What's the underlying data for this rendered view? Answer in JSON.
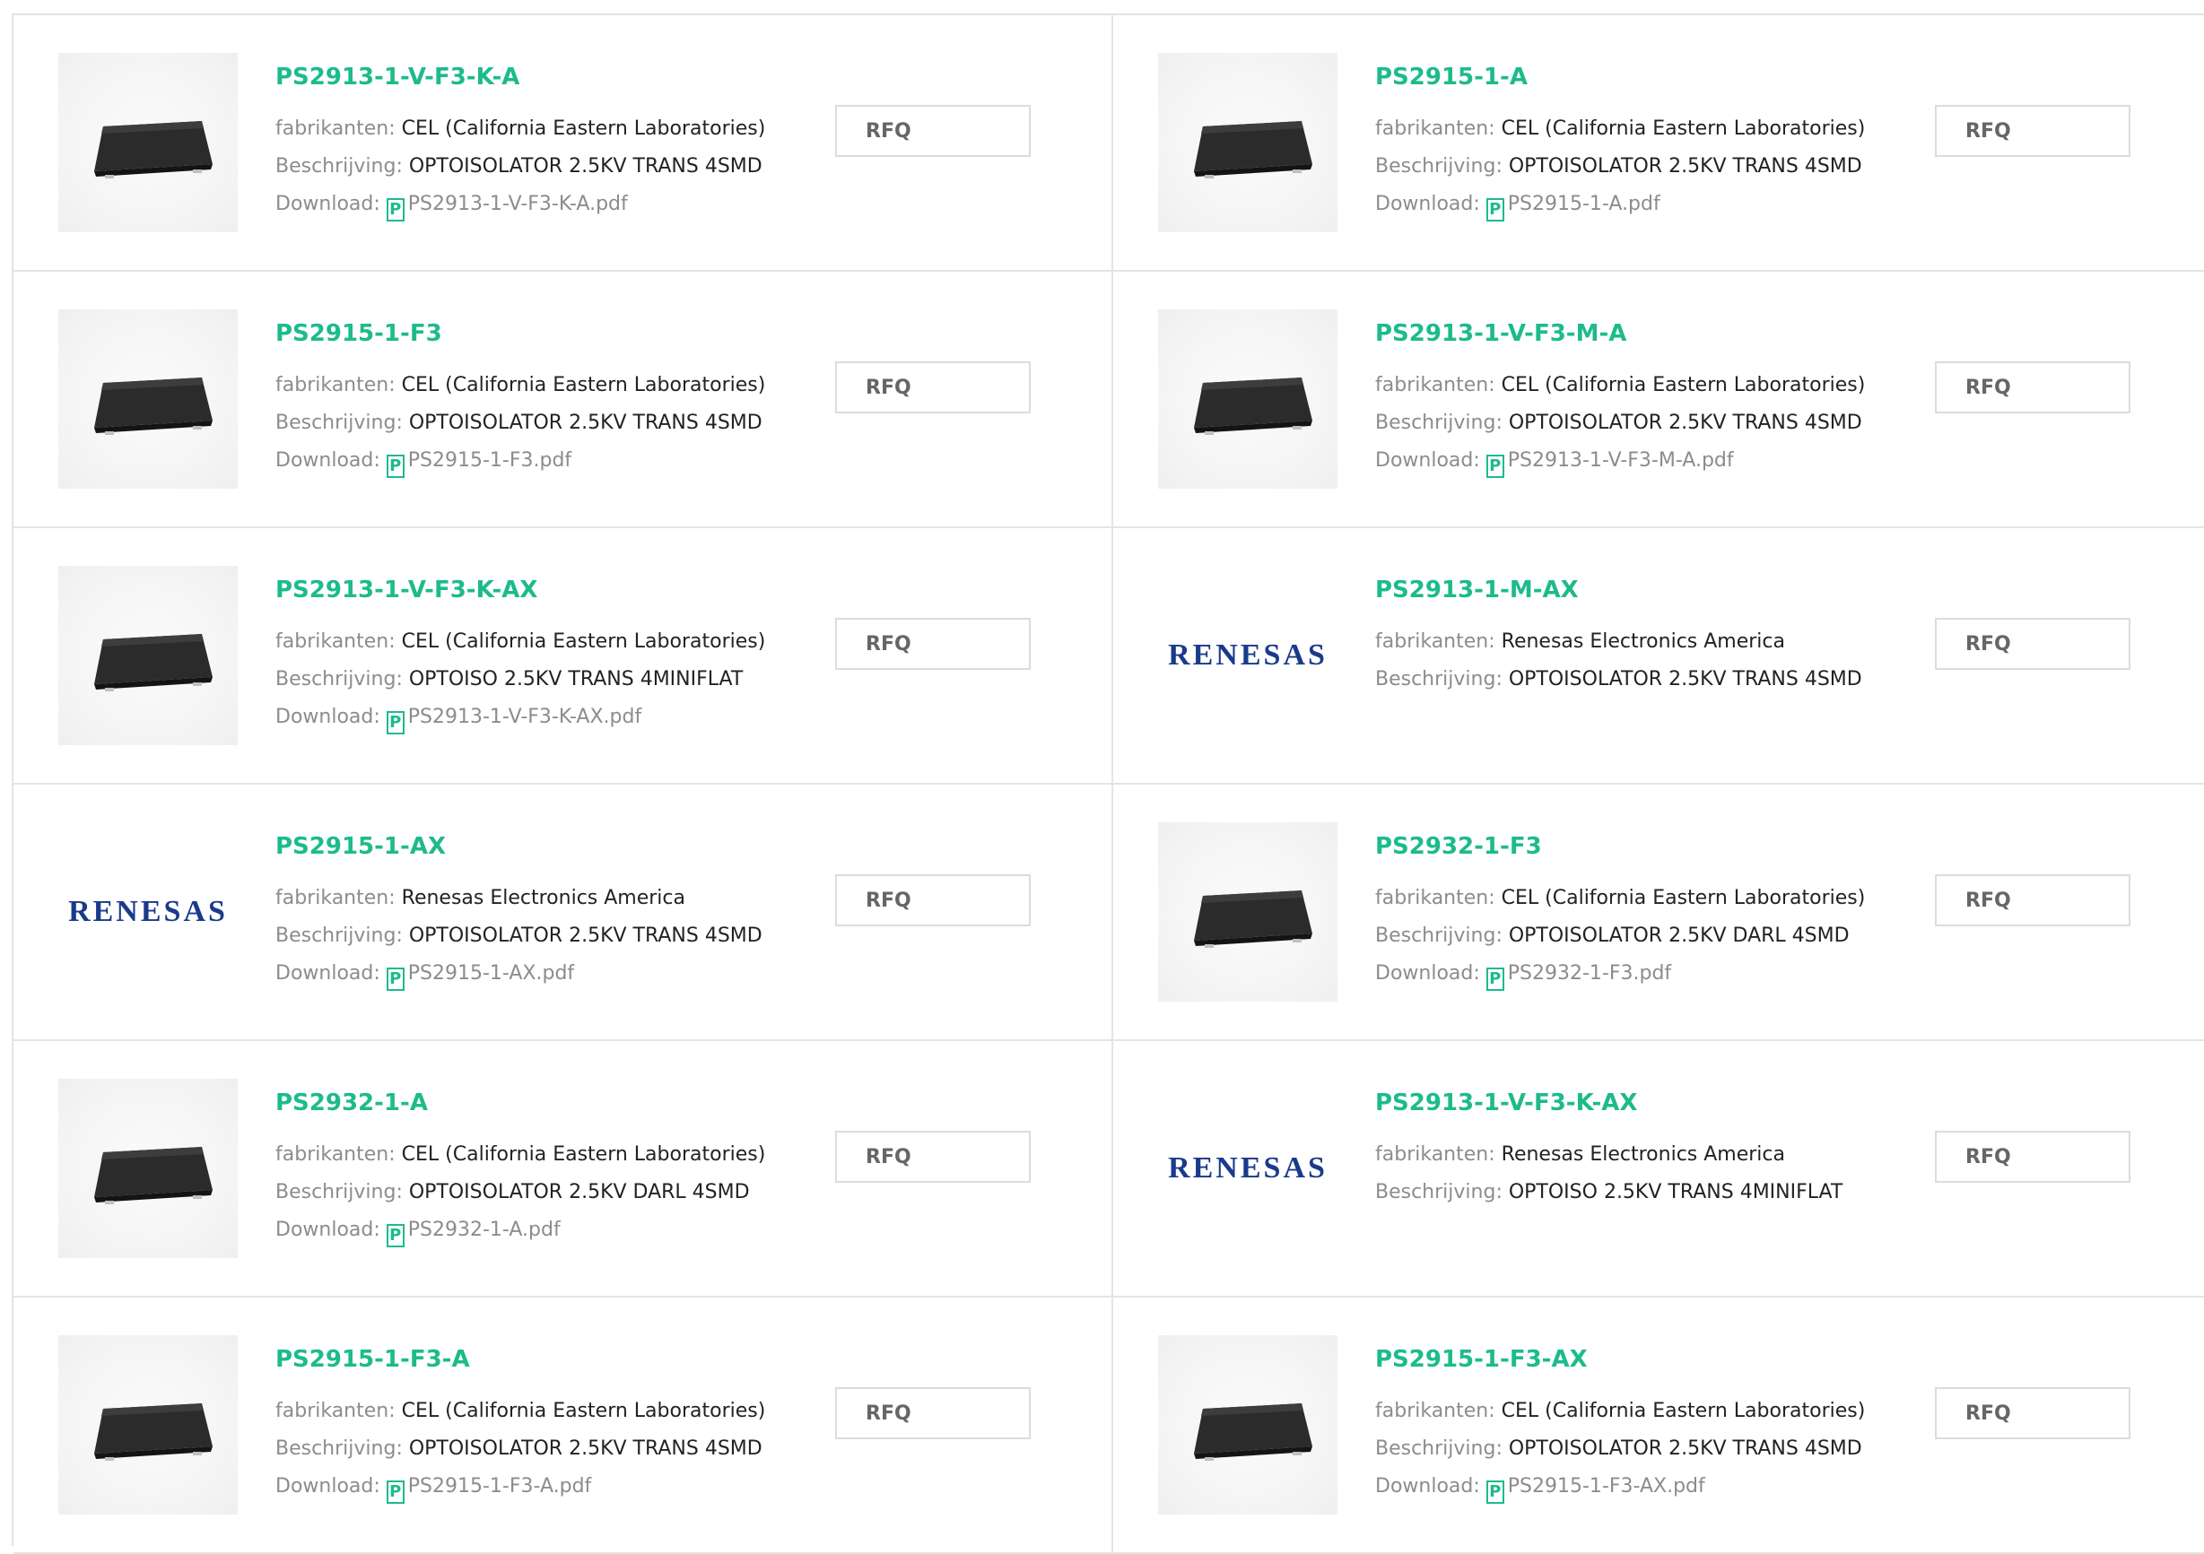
{
  "labels": {
    "manufacturer": "fabrikanten: ",
    "description": "Beschrijving: ",
    "download": "Download: ",
    "rfq": "RFQ"
  },
  "colors": {
    "accent": "#1dbb8c",
    "label_gray": "#8c8c8c",
    "border": "#e4e4e4",
    "renesas_blue": "#1a3a8c"
  },
  "products": [
    {
      "pn": "PS2913-1-V-F3-K-A",
      "manufacturer": "CEL (California Eastern Laboratories)",
      "description": "OPTOISOLATOR 2.5KV TRANS 4SMD",
      "pdf": "PS2913-1-V-F3-K-A.pdf",
      "image": "chip",
      "image_text": ""
    },
    {
      "pn": "PS2915-1-A",
      "manufacturer": "CEL (California Eastern Laboratories)",
      "description": "OPTOISOLATOR 2.5KV TRANS 4SMD",
      "pdf": "PS2915-1-A.pdf",
      "image": "chip",
      "image_text": ""
    },
    {
      "pn": "PS2915-1-F3",
      "manufacturer": "CEL (California Eastern Laboratories)",
      "description": "OPTOISOLATOR 2.5KV TRANS 4SMD",
      "pdf": "PS2915-1-F3.pdf",
      "image": "chip",
      "image_text": ""
    },
    {
      "pn": "PS2913-1-V-F3-M-A",
      "manufacturer": "CEL (California Eastern Laboratories)",
      "description": "OPTOISOLATOR 2.5KV TRANS 4SMD",
      "pdf": "PS2913-1-V-F3-M-A.pdf",
      "image": "chip",
      "image_text": ""
    },
    {
      "pn": "PS2913-1-V-F3-K-AX",
      "manufacturer": "CEL (California Eastern Laboratories)",
      "description": "OPTOISO 2.5KV TRANS 4MINIFLAT",
      "pdf": "PS2913-1-V-F3-K-AX.pdf",
      "image": "chip",
      "image_text": ""
    },
    {
      "pn": "PS2913-1-M-AX",
      "manufacturer": "Renesas Electronics America",
      "description": "OPTOISOLATOR 2.5KV TRANS 4SMD",
      "pdf": "",
      "image": "logo",
      "image_text": "RENESAS"
    },
    {
      "pn": "PS2915-1-AX",
      "manufacturer": "Renesas Electronics America",
      "description": "OPTOISOLATOR 2.5KV TRANS 4SMD",
      "pdf": "PS2915-1-AX.pdf",
      "image": "logo",
      "image_text": "RENESAS"
    },
    {
      "pn": "PS2932-1-F3",
      "manufacturer": "CEL (California Eastern Laboratories)",
      "description": "OPTOISOLATOR 2.5KV DARL 4SMD",
      "pdf": "PS2932-1-F3.pdf",
      "image": "chip",
      "image_text": ""
    },
    {
      "pn": "PS2932-1-A",
      "manufacturer": "CEL (California Eastern Laboratories)",
      "description": "OPTOISOLATOR 2.5KV DARL 4SMD",
      "pdf": "PS2932-1-A.pdf",
      "image": "chip",
      "image_text": ""
    },
    {
      "pn": "PS2913-1-V-F3-K-AX",
      "manufacturer": "Renesas Electronics America",
      "description": "OPTOISO 2.5KV TRANS 4MINIFLAT",
      "pdf": "",
      "image": "logo",
      "image_text": "RENESAS"
    },
    {
      "pn": "PS2915-1-F3-A",
      "manufacturer": "CEL (California Eastern Laboratories)",
      "description": "OPTOISOLATOR 2.5KV TRANS 4SMD",
      "pdf": "PS2915-1-F3-A.pdf",
      "image": "chip",
      "image_text": ""
    },
    {
      "pn": "PS2915-1-F3-AX",
      "manufacturer": "CEL (California Eastern Laboratories)",
      "description": "OPTOISOLATOR 2.5KV TRANS 4SMD",
      "pdf": "PS2915-1-F3-AX.pdf",
      "image": "chip",
      "image_text": ""
    }
  ]
}
